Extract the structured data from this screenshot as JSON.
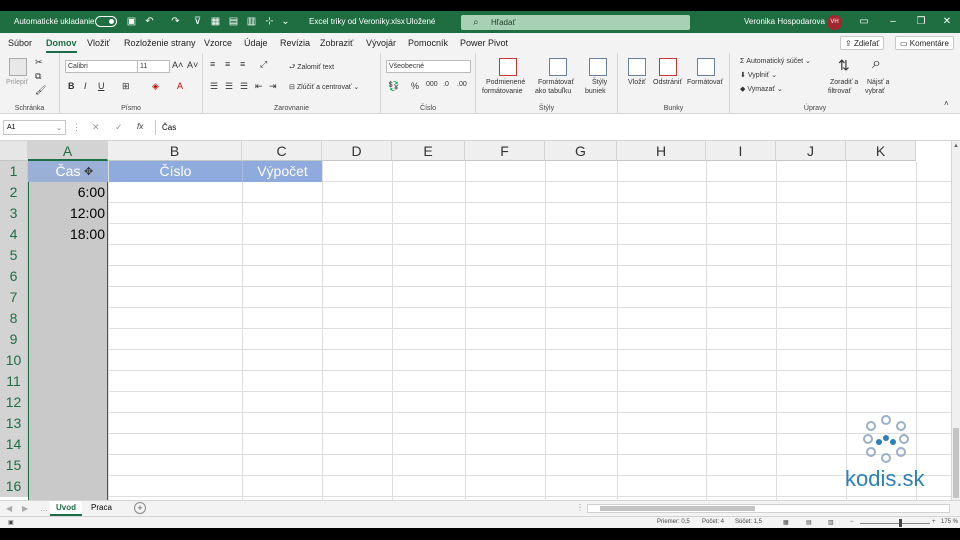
{
  "titlebar": {
    "autosave_label": "Automatické ukladanie",
    "filename": "Excel triky od Veroniky.xlsx",
    "saved_status": "Uložené",
    "search_placeholder": "Hľadať",
    "user_name": "Veronika Hospodarova",
    "user_initials": "VH"
  },
  "menu": {
    "tabs": [
      "Súbor",
      "Domov",
      "Vložiť",
      "Rozloženie strany",
      "Vzorce",
      "Údaje",
      "Revízia",
      "Zobraziť",
      "Vývojár",
      "Pomocník",
      "Power Pivot"
    ],
    "share": "Zdieľať",
    "comments": "Komentáre"
  },
  "ribbon": {
    "clipboard": {
      "paste": "Prilepiť",
      "label": "Schránka"
    },
    "font": {
      "name": "Calibri",
      "size": "11",
      "label": "Písmo"
    },
    "alignment": {
      "wrap": "Zalomiť text",
      "merge": "Zlúčiť a centrovať",
      "label": "Zarovnanie"
    },
    "number": {
      "format": "Všeobecné",
      "label": "Číslo"
    },
    "styles": {
      "conditional1": "Podmienené",
      "conditional2": "formátovanie",
      "table1": "Formátovať",
      "table2": "ako tabuľku",
      "cell1": "Štýly",
      "cell2": "buniek",
      "label": "Štýly"
    },
    "cells": {
      "insert": "Vložiť",
      "delete": "Odstrániť",
      "format": "Formátovať",
      "label": "Bunky"
    },
    "editing": {
      "autosum": "Automatický súčet",
      "fill": "Vyplniť",
      "clear": "Vymazať",
      "sort1": "Zoradiť a",
      "sort2": "filtrovať",
      "find1": "Nájsť a",
      "find2": "vybrať",
      "label": "Úpravy"
    }
  },
  "formula_bar": {
    "name_box": "A1",
    "fx": "fx",
    "content": "Čas"
  },
  "grid": {
    "columns": [
      "A",
      "B",
      "C",
      "D",
      "E",
      "F",
      "G",
      "H",
      "I",
      "J",
      "K"
    ],
    "rows": [
      "1",
      "2",
      "3",
      "4",
      "5",
      "6",
      "7",
      "8",
      "9",
      "10",
      "11",
      "12",
      "13",
      "14",
      "15",
      "16"
    ],
    "header_row": {
      "a1": "Čas",
      "b1": "Číslo",
      "c1": "Výpočet"
    },
    "times": [
      "6:00",
      "12:00",
      "18:00"
    ]
  },
  "sheets": {
    "tabs": [
      "Uvod",
      "Praca"
    ],
    "active": "Uvod"
  },
  "statusbar": {
    "average": "Priemer: 0,5",
    "count": "Počet: 4",
    "sum": "Súčet: 1,5",
    "zoom": "175 %"
  },
  "watermark": {
    "text": "kodis.sk"
  },
  "colors": {
    "excel_green": "#1e6e42",
    "header_fill": "#8faadc",
    "selection_gray": "#c8c8c8",
    "watermark_blue": "#2c7fb8"
  }
}
